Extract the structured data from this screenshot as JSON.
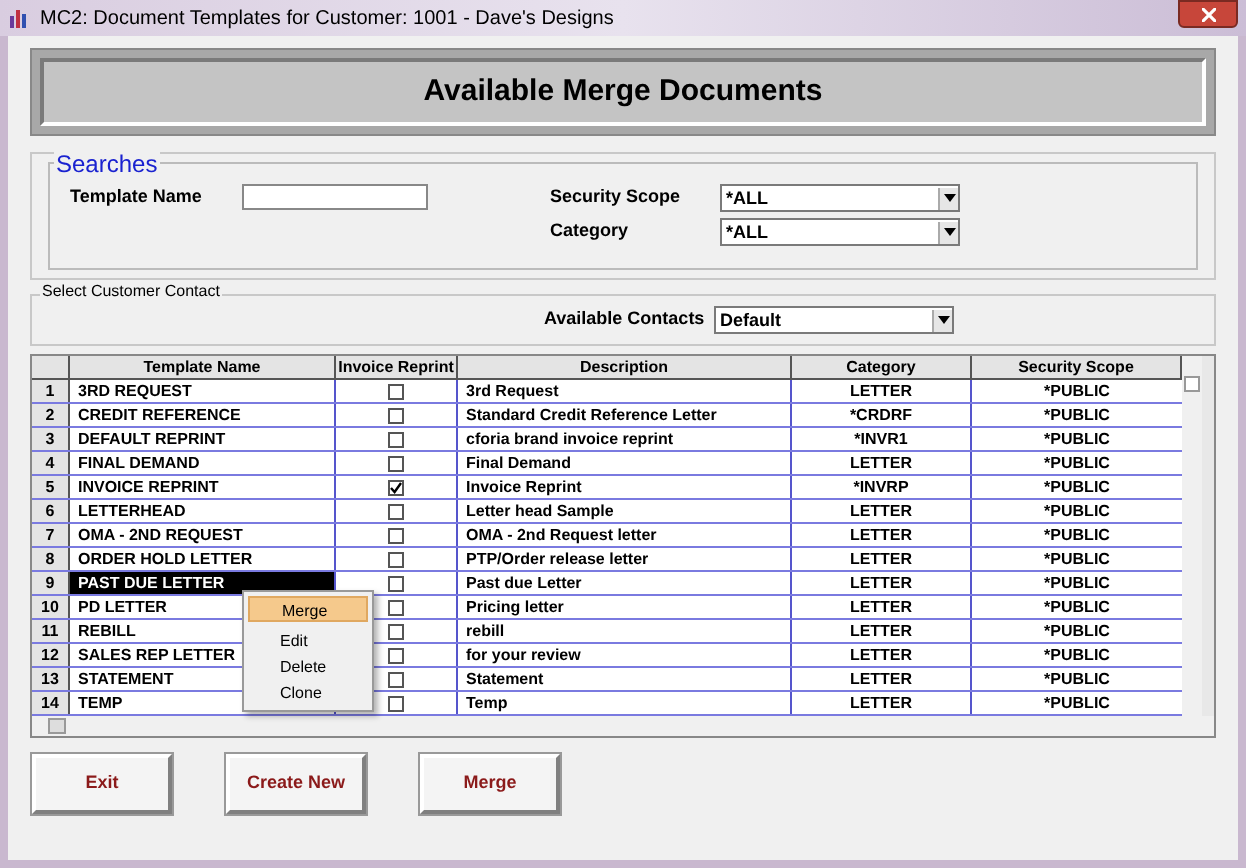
{
  "window": {
    "title": "MC2: Document Templates for Customer: 1001  -  Dave's Designs"
  },
  "heading": "Available Merge Documents",
  "searches": {
    "legend": "Searches",
    "template_name": {
      "label": "Template Name"
    },
    "security_scope": {
      "label": "Security Scope",
      "value": "*ALL"
    },
    "category": {
      "label": "Category",
      "value": "*ALL"
    }
  },
  "contact": {
    "legend": "Select Customer Contact",
    "label": "Available Contacts",
    "value": "Default"
  },
  "table": {
    "columns": [
      "Template Name",
      "Invoice Reprint",
      "Description",
      "Category",
      "Security Scope"
    ],
    "rows": [
      {
        "number": "1",
        "name": "3RD REQUEST",
        "invoice_reprint": false,
        "description": "3rd Request",
        "category": "LETTER",
        "scope": "*PUBLIC",
        "selected": false
      },
      {
        "number": "2",
        "name": "CREDIT REFERENCE",
        "invoice_reprint": false,
        "description": "Standard Credit Reference Letter",
        "category": "*CRDRF",
        "scope": "*PUBLIC",
        "selected": false
      },
      {
        "number": "3",
        "name": "DEFAULT REPRINT",
        "invoice_reprint": false,
        "description": "cforia brand invoice reprint",
        "category": "*INVR1",
        "scope": "*PUBLIC",
        "selected": false
      },
      {
        "number": "4",
        "name": "FINAL DEMAND",
        "invoice_reprint": false,
        "description": "Final Demand",
        "category": "LETTER",
        "scope": "*PUBLIC",
        "selected": false
      },
      {
        "number": "5",
        "name": "INVOICE REPRINT",
        "invoice_reprint": true,
        "description": "Invoice Reprint",
        "category": "*INVRP",
        "scope": "*PUBLIC",
        "selected": false
      },
      {
        "number": "6",
        "name": "LETTERHEAD",
        "invoice_reprint": false,
        "description": "Letter head Sample",
        "category": "LETTER",
        "scope": "*PUBLIC",
        "selected": false
      },
      {
        "number": "7",
        "name": "OMA - 2ND REQUEST",
        "invoice_reprint": false,
        "description": "OMA - 2nd Request letter",
        "category": "LETTER",
        "scope": "*PUBLIC",
        "selected": false
      },
      {
        "number": "8",
        "name": "ORDER HOLD LETTER",
        "invoice_reprint": false,
        "description": "PTP/Order release letter",
        "category": "LETTER",
        "scope": "*PUBLIC",
        "selected": false
      },
      {
        "number": "9",
        "name": "PAST DUE LETTER",
        "invoice_reprint": false,
        "description": "Past due Letter",
        "category": "LETTER",
        "scope": "*PUBLIC",
        "selected": true
      },
      {
        "number": "10",
        "name": "PD LETTER",
        "invoice_reprint": false,
        "description": "Pricing letter",
        "category": "LETTER",
        "scope": "*PUBLIC",
        "selected": false
      },
      {
        "number": "11",
        "name": "REBILL",
        "invoice_reprint": false,
        "description": "rebill",
        "category": "LETTER",
        "scope": "*PUBLIC",
        "selected": false
      },
      {
        "number": "12",
        "name": "SALES REP LETTER",
        "invoice_reprint": false,
        "description": "for your review",
        "category": "LETTER",
        "scope": "*PUBLIC",
        "selected": false
      },
      {
        "number": "13",
        "name": "STATEMENT",
        "invoice_reprint": false,
        "description": "Statement",
        "category": "LETTER",
        "scope": "*PUBLIC",
        "selected": false
      },
      {
        "number": "14",
        "name": "TEMP",
        "invoice_reprint": false,
        "description": "Temp",
        "category": "LETTER",
        "scope": "*PUBLIC",
        "selected": false
      }
    ]
  },
  "context_menu": [
    {
      "label": "Merge",
      "selected": true
    },
    {
      "label": "Edit",
      "selected": false
    },
    {
      "label": "Delete",
      "selected": false
    },
    {
      "label": "Clone",
      "selected": false
    }
  ],
  "buttons": [
    "Exit",
    "Create New",
    "Merge"
  ]
}
